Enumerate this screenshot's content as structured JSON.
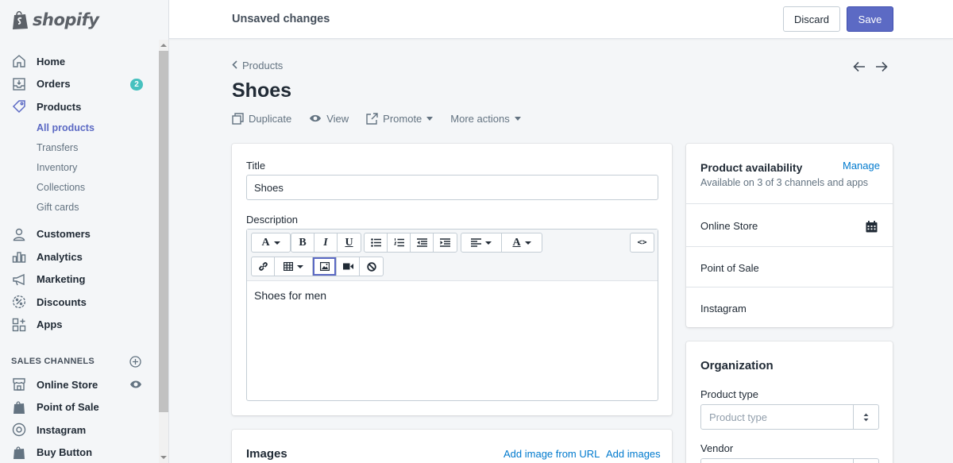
{
  "brand": {
    "name": "shopify",
    "accent": "#5c6ac4",
    "badge_color": "#47c1bf",
    "link_color": "#007ace"
  },
  "sidebar": {
    "items": [
      {
        "label": "Home",
        "icon": "home-icon"
      },
      {
        "label": "Orders",
        "icon": "orders-icon",
        "badge": "2"
      },
      {
        "label": "Products",
        "icon": "tag-icon",
        "active": true
      }
    ],
    "product_subitems": [
      {
        "label": "All products",
        "active": true
      },
      {
        "label": "Transfers"
      },
      {
        "label": "Inventory"
      },
      {
        "label": "Collections"
      },
      {
        "label": "Gift cards"
      }
    ],
    "more_items": [
      {
        "label": "Customers",
        "icon": "person-icon"
      },
      {
        "label": "Analytics",
        "icon": "chart-icon"
      },
      {
        "label": "Marketing",
        "icon": "megaphone-icon"
      },
      {
        "label": "Discounts",
        "icon": "discount-icon"
      },
      {
        "label": "Apps",
        "icon": "apps-icon"
      }
    ],
    "sales_channels_title": "SALES CHANNELS",
    "channels": [
      {
        "label": "Online Store",
        "icon": "store-icon"
      },
      {
        "label": "Point of Sale",
        "icon": "shopify-bag-icon"
      },
      {
        "label": "Instagram",
        "icon": "instagram-icon"
      },
      {
        "label": "Buy Button",
        "icon": "shopify-bag-icon"
      }
    ]
  },
  "topbar": {
    "status": "Unsaved changes",
    "discard_label": "Discard",
    "save_label": "Save"
  },
  "header": {
    "breadcrumb": "Products",
    "title": "Shoes",
    "actions": {
      "duplicate": "Duplicate",
      "view": "View",
      "promote": "Promote",
      "more": "More actions"
    }
  },
  "main_card": {
    "title_label": "Title",
    "title_value": "Shoes",
    "description_label": "Description",
    "description_value": "Shoes for men"
  },
  "images_card": {
    "heading": "Images",
    "add_url": "Add image from URL",
    "add_images": "Add images"
  },
  "availability": {
    "heading": "Product availability",
    "manage": "Manage",
    "subtitle": "Available on 3 of 3 channels and apps",
    "channels": [
      "Online Store",
      "Point of Sale",
      "Instagram"
    ]
  },
  "organization": {
    "heading": "Organization",
    "product_type_label": "Product type",
    "product_type_placeholder": "Product type",
    "vendor_label": "Vendor"
  }
}
